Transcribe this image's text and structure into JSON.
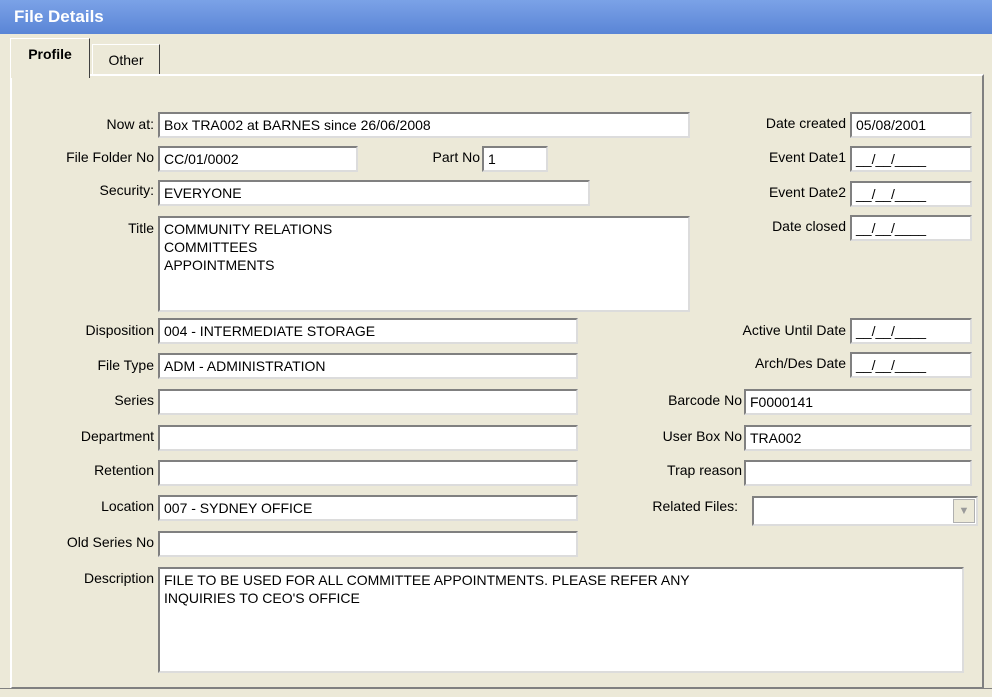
{
  "window": {
    "title": "File Details"
  },
  "tabs": [
    {
      "label": "Profile",
      "active": true
    },
    {
      "label": "Other",
      "active": false
    }
  ],
  "labels": {
    "now_at": "Now at:",
    "file_folder_no": "File Folder No",
    "part_no": "Part No",
    "security": "Security:",
    "title": "Title",
    "disposition": "Disposition",
    "file_type": "File Type",
    "series": "Series",
    "department": "Department",
    "retention": "Retention",
    "location": "Location",
    "old_series_no": "Old Series No",
    "description": "Description",
    "date_created": "Date created",
    "event_date1": "Event Date1",
    "event_date2": "Event Date2",
    "date_closed": "Date closed",
    "active_until_date": "Active Until Date",
    "arch_des_date": "Arch/Des Date",
    "barcode_no": "Barcode No",
    "user_box_no": "User Box No",
    "trap_reason": "Trap reason",
    "related_files": "Related Files:"
  },
  "values": {
    "now_at": "Box TRA002 at BARNES since 26/06/2008",
    "file_folder_no": "CC/01/0002",
    "part_no": "1",
    "security": "EVERYONE",
    "title": "COMMUNITY RELATIONS\nCOMMITTEES\nAPPOINTMENTS",
    "disposition": "004 - INTERMEDIATE STORAGE",
    "file_type": "ADM - ADMINISTRATION",
    "series": "",
    "department": "",
    "retention": "",
    "location": "007 - SYDNEY OFFICE",
    "old_series_no": "",
    "description": "FILE TO BE USED FOR ALL COMMITTEE APPOINTMENTS. PLEASE REFER ANY\nINQUIRIES TO CEO'S OFFICE",
    "date_created": "05/08/2001",
    "event_date1": "__/__/____",
    "event_date2": "__/__/____",
    "date_closed": "__/__/____",
    "active_until_date": "__/__/____",
    "arch_des_date": "__/__/____",
    "barcode_no": "F0000141",
    "user_box_no": "TRA002",
    "trap_reason": "",
    "related_files": ""
  },
  "icons": {
    "dropdown": "chevron-down-icon"
  },
  "colors": {
    "titlebar": "#5a85d6",
    "window_bg": "#ece9d8",
    "field_bg": "#ffffff"
  }
}
